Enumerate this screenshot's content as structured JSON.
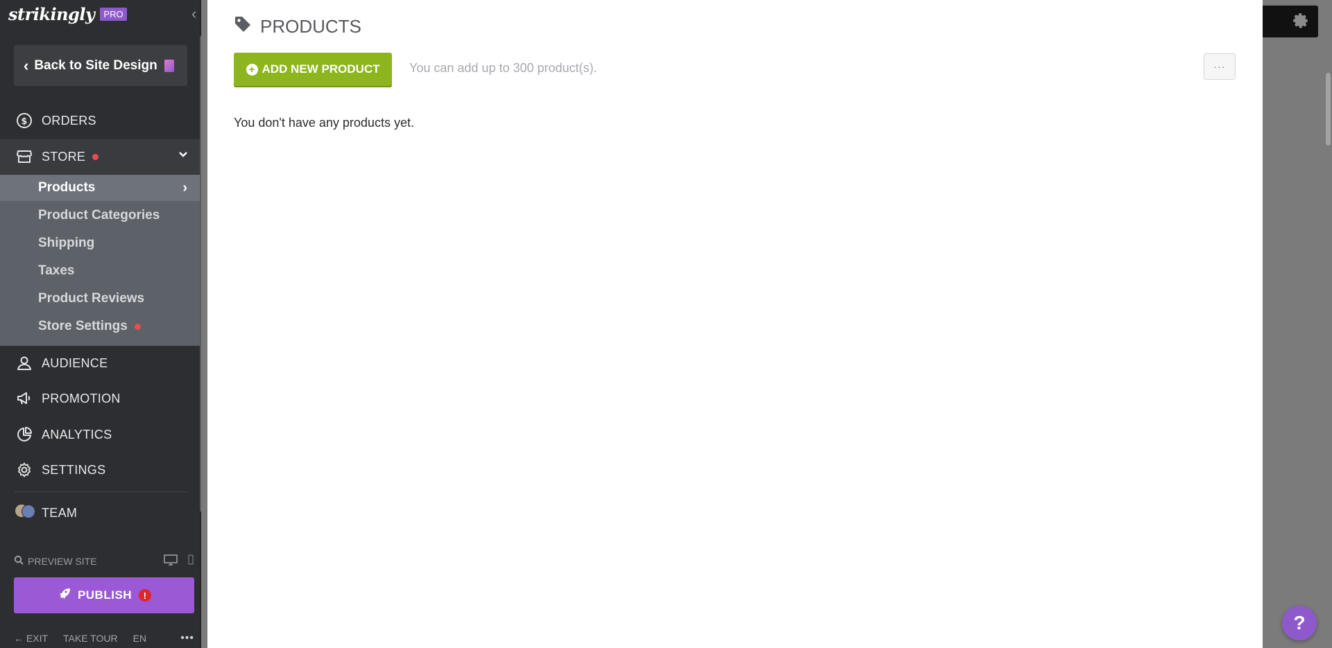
{
  "brand": {
    "logo": "strikingly",
    "badge": "PRO"
  },
  "sidebar": {
    "back_label": "Back to Site Design",
    "nav": {
      "orders": "ORDERS",
      "store": "STORE",
      "audience": "AUDIENCE",
      "promotion": "PROMOTION",
      "analytics": "ANALYTICS",
      "settings": "SETTINGS",
      "team": "TEAM"
    },
    "store_items": [
      {
        "label": "Products"
      },
      {
        "label": "Product Categories"
      },
      {
        "label": "Shipping"
      },
      {
        "label": "Taxes"
      },
      {
        "label": "Product Reviews"
      },
      {
        "label": "Store Settings"
      }
    ],
    "preview_label": "PREVIEW SITE",
    "publish_label": "PUBLISH",
    "publish_alert": "!",
    "footer": {
      "exit": "EXIT",
      "tour": "TAKE TOUR",
      "lang": "EN",
      "more": "•••"
    }
  },
  "main": {
    "title": "PRODUCTS",
    "add_button": "ADD NEW PRODUCT",
    "limit_note": "You can add up to 300 product(s).",
    "more_button": "···",
    "empty_message": "You don't have any products yet."
  },
  "help_label": "?",
  "colors": {
    "sidebar_bg": "#2d2e31",
    "submenu_bg": "#5d6168",
    "accent_green": "#8db51e",
    "accent_purple": "#9b59d6",
    "alert_red": "#e64d4d"
  }
}
